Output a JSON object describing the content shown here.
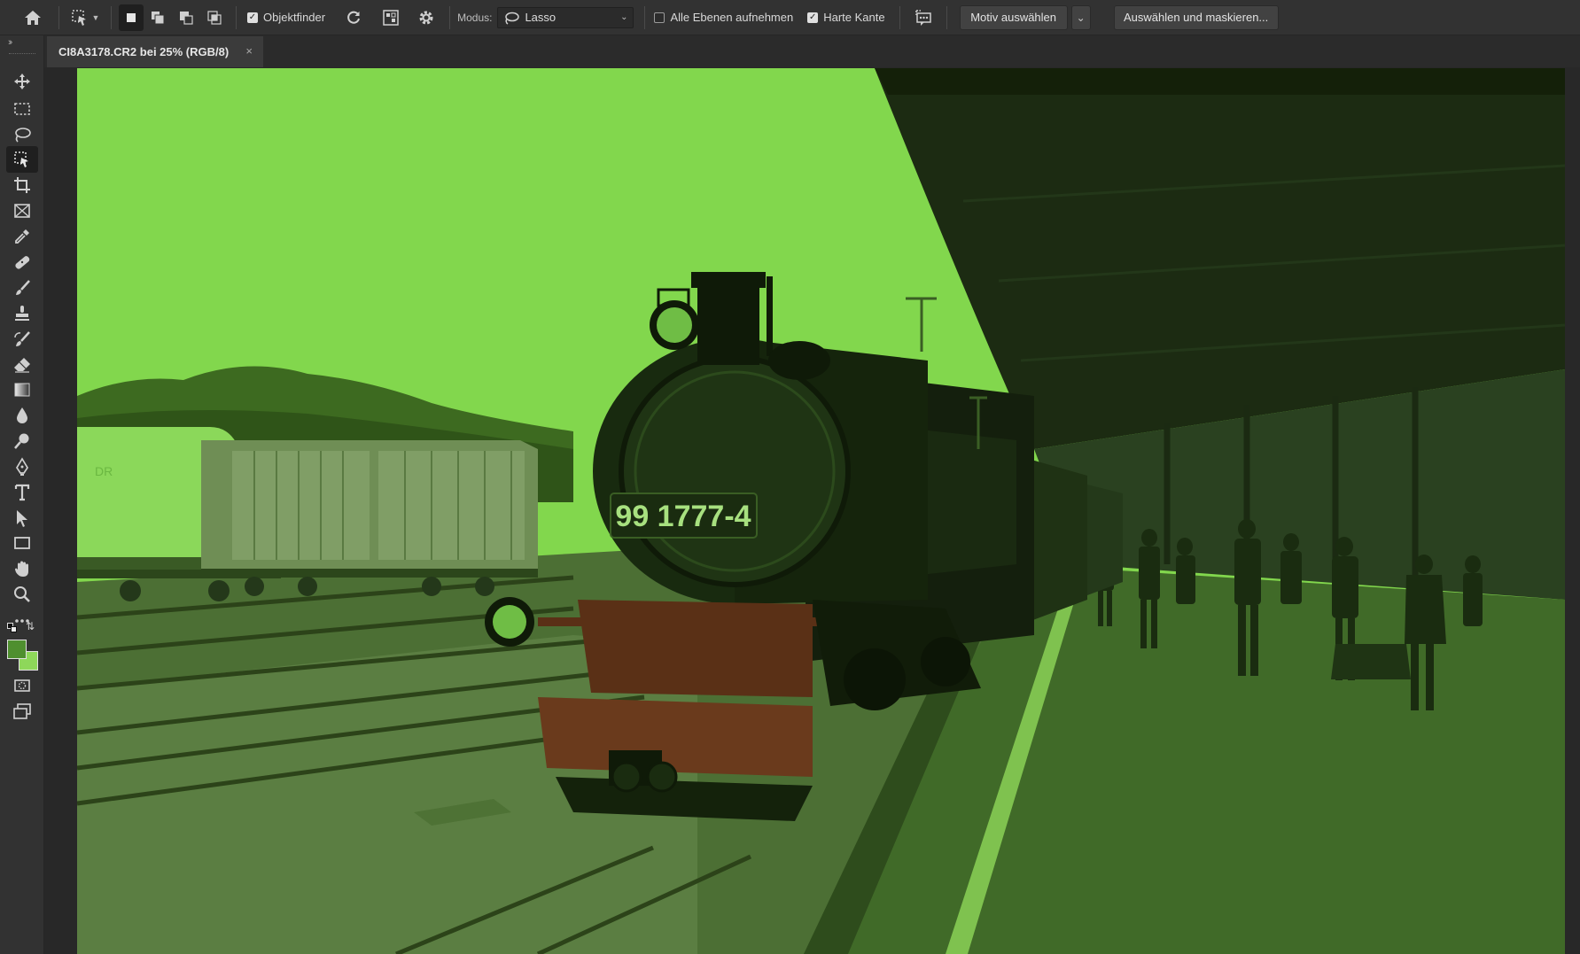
{
  "options_bar": {
    "objektfinder_label": "Objektfinder",
    "modus_label": "Modus:",
    "modus_value": "Lasso",
    "alle_ebenen_label": "Alle Ebenen aufnehmen",
    "harte_kante_label": "Harte Kante",
    "motiv_auswaehlen_label": "Motiv auswählen",
    "auswaehlen_maskieren_label": "Auswählen und maskieren...",
    "objektfinder_checked": true,
    "alle_ebenen_checked": false,
    "harte_kante_checked": true
  },
  "document": {
    "tab_title": "CI8A3178.CR2 bei 25% (RGB/8)",
    "close_glyph": "×"
  },
  "canvas_text": {
    "locomotive_number": "99 1777-4",
    "wagon_marking": "DR"
  },
  "colors": {
    "overlay_green": "#82d74d",
    "foreground_swatch": "#4f8f2f",
    "background_swatch": "#8ed75a"
  },
  "tools": [
    "move-icon",
    "rect-marquee-icon",
    "lasso-icon",
    "object-selection-icon",
    "crop-icon",
    "frame-icon",
    "eyedropper-icon",
    "healing-brush-icon",
    "brush-icon",
    "clone-stamp-icon",
    "history-brush-icon",
    "eraser-icon",
    "gradient-icon",
    "blur-icon",
    "dodge-icon",
    "pen-icon",
    "type-icon",
    "path-selection-icon",
    "rectangle-icon",
    "hand-icon",
    "zoom-icon",
    "more-tools-icon"
  ]
}
